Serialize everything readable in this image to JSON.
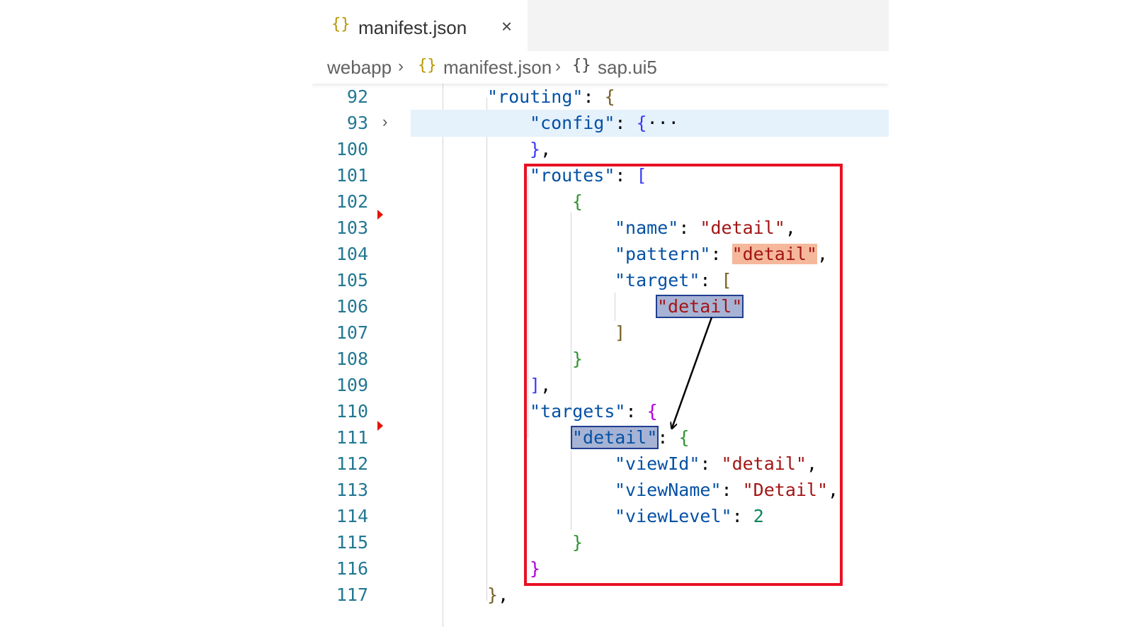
{
  "tab": {
    "icon": "{}",
    "label": "manifest.json",
    "close_icon": "×"
  },
  "breadcrumb": {
    "items": [
      {
        "icon": "",
        "label": "webapp"
      },
      {
        "icon": "{}",
        "label": "manifest.json"
      },
      {
        "icon": "{}",
        "label": "sap.ui5"
      }
    ],
    "separator": "›"
  },
  "code": {
    "line_numbers": [
      "92",
      "93",
      "100",
      "101",
      "102",
      "103",
      "104",
      "105",
      "106",
      "107",
      "108",
      "109",
      "110",
      "111",
      "112",
      "113",
      "114",
      "115",
      "116",
      "117"
    ],
    "fold_glyph": "›",
    "ellipsis": "···",
    "keys": {
      "routing": "\"routing\"",
      "config": "\"config\"",
      "routes": "\"routes\"",
      "name": "\"name\"",
      "pattern": "\"pattern\"",
      "target": "\"target\"",
      "targets": "\"targets\"",
      "detail_key": "\"detail\"",
      "viewId": "\"viewId\"",
      "viewName": "\"viewName\"",
      "viewLevel": "\"viewLevel\""
    },
    "values": {
      "name": "\"detail\"",
      "pattern": "\"detail\"",
      "target_item": "\"detail\"",
      "viewId": "\"detail\"",
      "viewName": "\"Detail\"",
      "viewLevel": "2"
    }
  },
  "colors": {
    "annotation_box": "#e81123",
    "line_number": "#237893",
    "json_key": "#0451a5",
    "json_string": "#a31515",
    "json_number": "#098658",
    "highlight_pattern": "#f5b89a",
    "highlight_linked": "#a7b3d4"
  }
}
